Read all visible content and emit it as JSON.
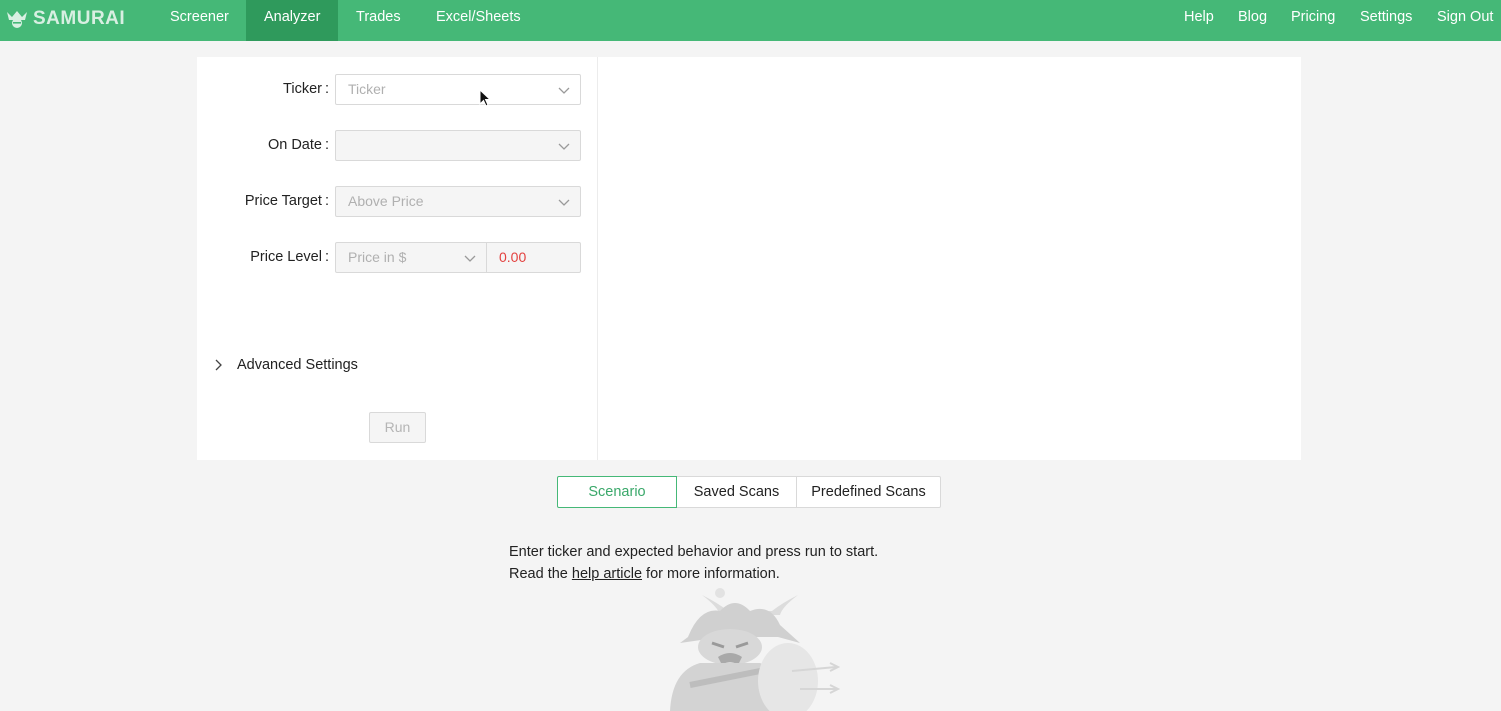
{
  "brand": {
    "name": "SAMURAI"
  },
  "nav": {
    "left": [
      {
        "label": "Screener",
        "active": false
      },
      {
        "label": "Analyzer",
        "active": true
      },
      {
        "label": "Trades",
        "active": false
      },
      {
        "label": "Excel/Sheets",
        "active": false
      }
    ],
    "right": [
      "Help",
      "Blog",
      "Pricing",
      "Settings",
      "Sign Out"
    ]
  },
  "form": {
    "ticker": {
      "label": "Ticker",
      "placeholder": "Ticker"
    },
    "on_date": {
      "label": "On Date",
      "value": ""
    },
    "price_target": {
      "label": "Price Target",
      "value": "Above Price"
    },
    "price_level": {
      "label": "Price Level",
      "unit": "Price in $",
      "value": "0.00"
    },
    "advanced_label": "Advanced Settings",
    "run_label": "Run"
  },
  "tabs": [
    {
      "label": "Scenario",
      "active": true
    },
    {
      "label": "Saved Scans",
      "active": false
    },
    {
      "label": "Predefined Scans",
      "active": false
    }
  ],
  "message": {
    "line1": "Enter ticker and expected behavior and press run to start.",
    "line2_prefix": "Read the",
    "link": "help article",
    "line2_suffix": "for more information."
  },
  "colors": {
    "brand_green": "#45b877",
    "active_nav": "#2f9a5c",
    "value_red": "#e3413f"
  }
}
